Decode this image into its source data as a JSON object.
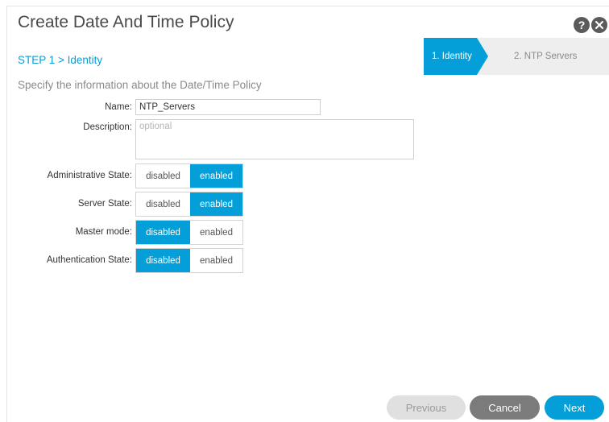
{
  "dialog": {
    "title": "Create Date And Time Policy",
    "step_label": "STEP 1 > Identity",
    "section_hint": "Specify the information about the Date/Time Policy"
  },
  "header_icons": {
    "help": "question-icon",
    "close": "close-icon"
  },
  "wizard": {
    "steps": [
      {
        "label": "1. Identity",
        "active": true
      },
      {
        "label": "2. NTP Servers",
        "active": false
      }
    ]
  },
  "form": {
    "name": {
      "label": "Name:",
      "value": "NTP_Servers"
    },
    "description": {
      "label": "Description:",
      "placeholder": "optional"
    },
    "admin_state": {
      "label": "Administrative State:",
      "options": [
        "disabled",
        "enabled"
      ],
      "selected": "enabled"
    },
    "server_state": {
      "label": "Server State:",
      "options": [
        "disabled",
        "enabled"
      ],
      "selected": "enabled"
    },
    "master_mode": {
      "label": "Master mode:",
      "options": [
        "disabled",
        "enabled"
      ],
      "selected": "disabled"
    },
    "auth_state": {
      "label": "Authentication State:",
      "options": [
        "disabled",
        "enabled"
      ],
      "selected": "disabled"
    }
  },
  "footer": {
    "previous": "Previous",
    "cancel": "Cancel",
    "next": "Next"
  },
  "colors": {
    "accent": "#049fd9",
    "button_gray": "#7b7b7b",
    "disabled_button": "#e0e0e0"
  }
}
